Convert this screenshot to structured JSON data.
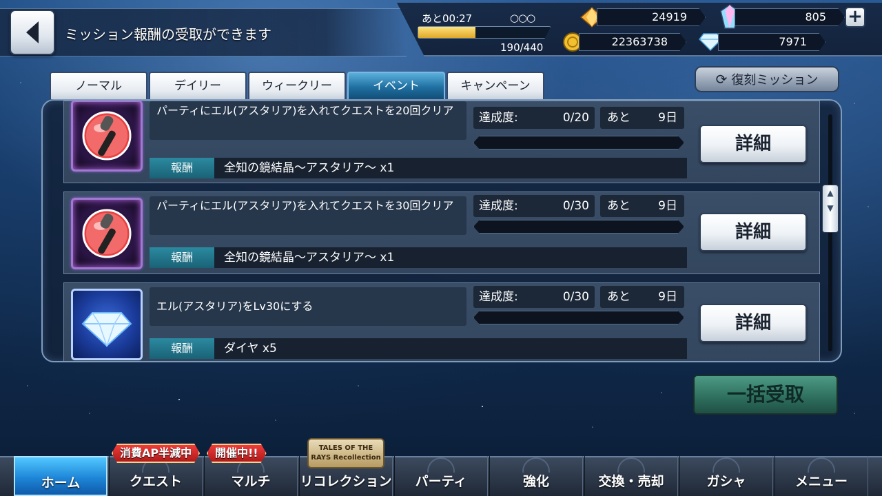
{
  "header": {
    "title": "ミッション報酬の受取ができます"
  },
  "status": {
    "ap_time": "あと00:27",
    "ap_circles": "○○○",
    "ap_count": "190/440",
    "ap_fill_fraction": 0.43,
    "orange_crystal": "24919",
    "rainbow_crystal": "805",
    "gald": "22363738",
    "diamond": "7971"
  },
  "tabs": [
    {
      "label": "ノーマル"
    },
    {
      "label": "デイリー"
    },
    {
      "label": "ウィークリー"
    },
    {
      "label": "イベント"
    },
    {
      "label": "キャンペーン"
    }
  ],
  "revival_label": "復刻ミッション",
  "progress_label": "達成度:",
  "remain_label": "あと",
  "reward_label": "報酬",
  "detail_label": "詳細",
  "missions": [
    {
      "desc": "パーティにエル(アスタリア)を入れてクエストを20回クリア",
      "progress": "0/20",
      "remain": "9日",
      "reward": "全知の鏡結晶～アスタリア～ x1"
    },
    {
      "desc": "パーティにエル(アスタリア)を入れてクエストを30回クリア",
      "progress": "0/30",
      "remain": "9日",
      "reward": "全知の鏡結晶～アスタリア～ x1"
    },
    {
      "desc": "エル(アスタリア)をLv30にする",
      "progress": "0/30",
      "remain": "9日",
      "reward": "ダイヤ x5"
    }
  ],
  "bulk_label": "一括受取",
  "nav": [
    {
      "label": "ホーム"
    },
    {
      "label": "クエスト"
    },
    {
      "label": "マルチ"
    },
    {
      "label": "リコレクション"
    },
    {
      "label": "パーティ"
    },
    {
      "label": "強化"
    },
    {
      "label": "交換・売却"
    },
    {
      "label": "ガシャ"
    },
    {
      "label": "メニュー"
    }
  ],
  "badges": {
    "quest": "消費AP半減中",
    "multi": "開催中!!"
  },
  "collab_logo": "TALES OF THE RAYS Recollection"
}
